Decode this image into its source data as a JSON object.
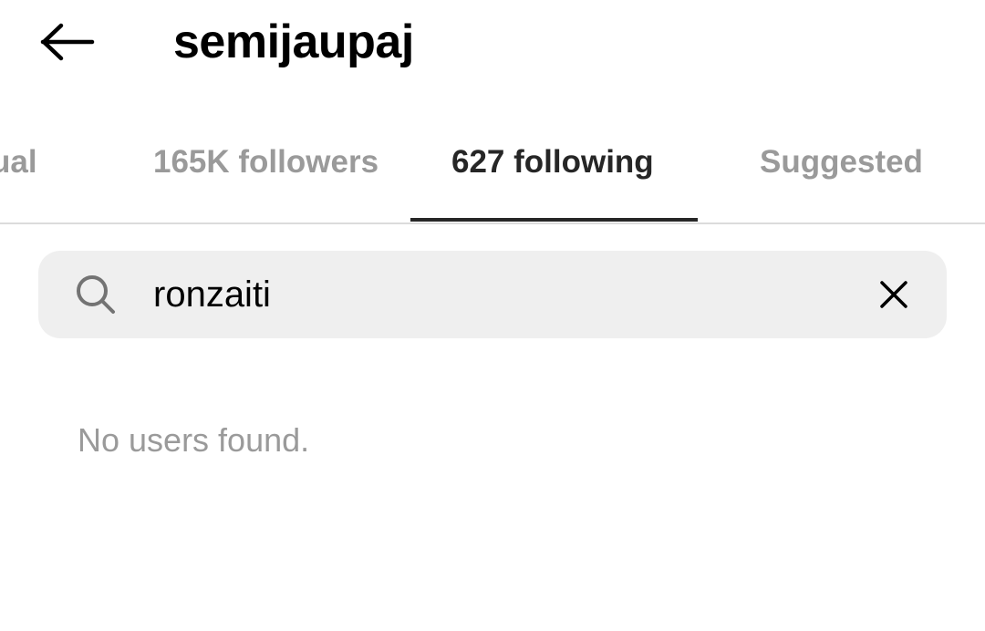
{
  "header": {
    "username": "semijaupaj",
    "back_icon": "arrow-left-icon"
  },
  "tabs": [
    {
      "label": "ual",
      "active": false
    },
    {
      "label": "165K followers",
      "active": false
    },
    {
      "label": "627 following",
      "active": true
    },
    {
      "label": "Suggested",
      "active": false
    }
  ],
  "search": {
    "value": "ronzaiti",
    "icon": "search-icon",
    "clear_icon": "close-icon"
  },
  "results": {
    "empty_message": "No users found."
  },
  "colors": {
    "text_primary": "#000000",
    "text_muted": "#9a9a9a",
    "search_bg": "#efefef",
    "divider": "#dbdbdb",
    "active_indicator": "#262626"
  }
}
